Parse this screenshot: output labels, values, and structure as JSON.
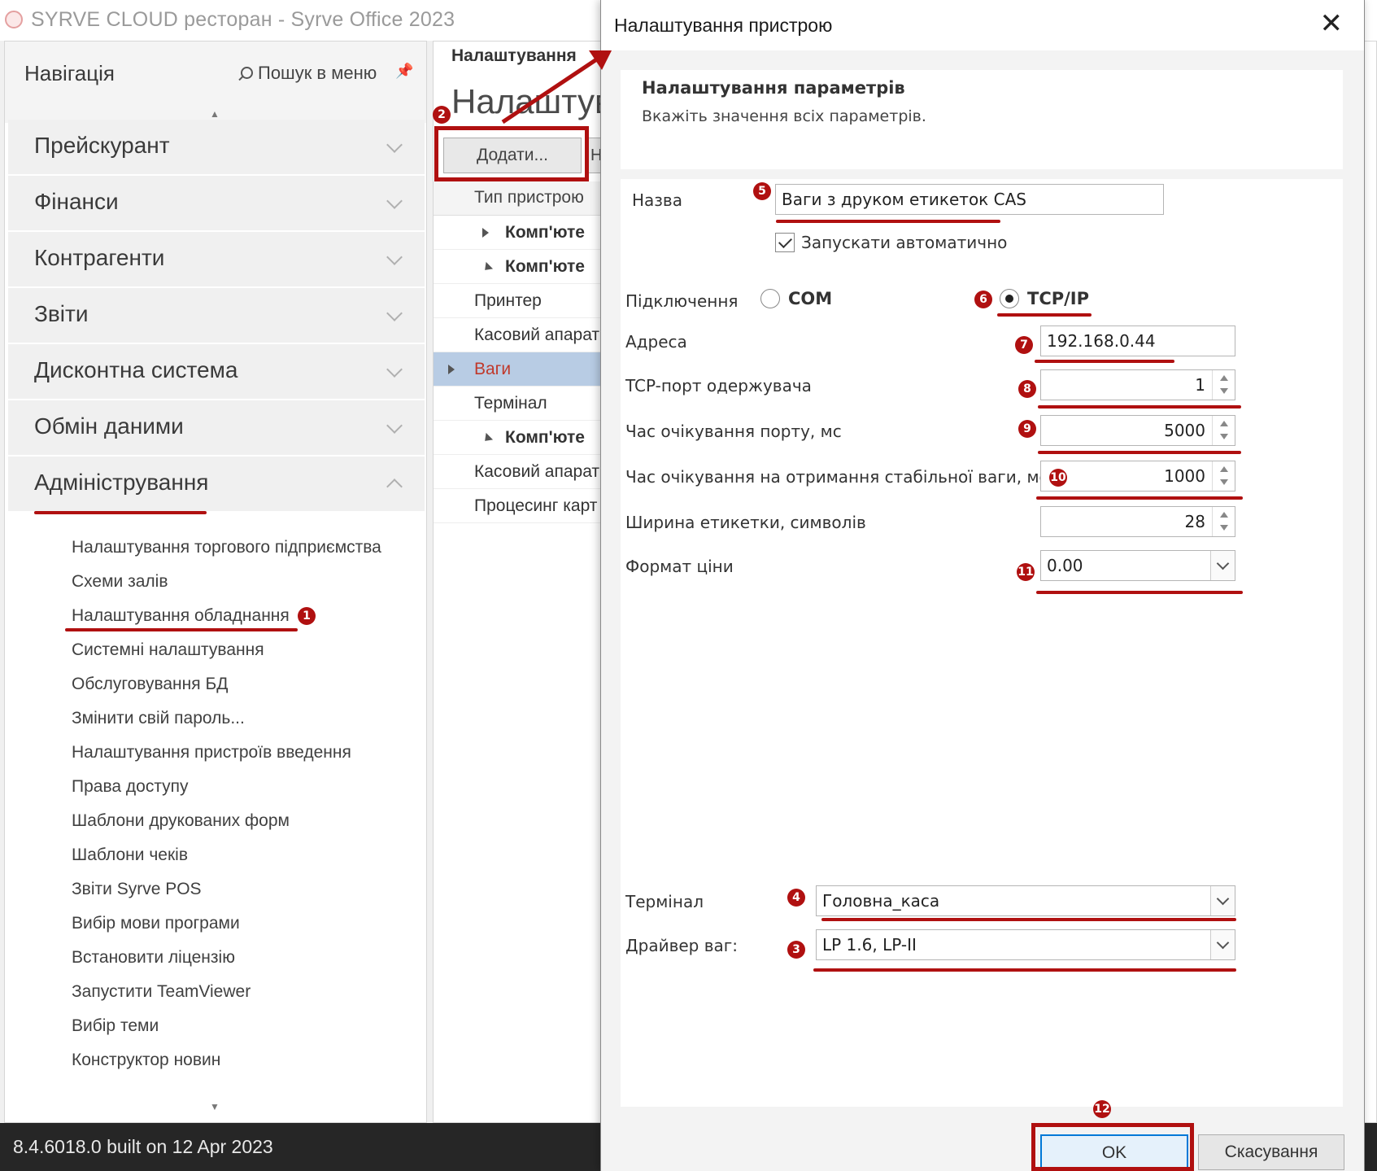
{
  "app": {
    "title": "SYRVE CLOUD ресторан - Syrve Office 2023",
    "status": "8.4.6018.0 built on 12 Apr 2023"
  },
  "nav": {
    "title": "Навігація",
    "search": "Пошук в меню",
    "sections": [
      {
        "label": "Прейскурант"
      },
      {
        "label": "Фінанси"
      },
      {
        "label": "Контрагенти"
      },
      {
        "label": "Звіти"
      },
      {
        "label": "Дисконтна система"
      },
      {
        "label": "Обмін даними"
      },
      {
        "label": "Адміністрування"
      }
    ],
    "items": [
      {
        "label": "Налаштування торгового підприємства"
      },
      {
        "label": "Схеми залів"
      },
      {
        "label": "Налаштування обладнання"
      },
      {
        "label": "Системні налаштування"
      },
      {
        "label": "Обслуговування БД"
      },
      {
        "label": "Змінити свій пароль..."
      },
      {
        "label": "Налаштування пристроїв введення"
      },
      {
        "label": "Права доступу"
      },
      {
        "label": "Шаблони друкованих форм"
      },
      {
        "label": "Шаблони чеків"
      },
      {
        "label": "Звіти Syrve POS"
      },
      {
        "label": "Вибір мови програми"
      },
      {
        "label": "Встановити ліцензію"
      },
      {
        "label": "Запустити TeamViewer"
      },
      {
        "label": "Вибір теми"
      },
      {
        "label": "Конструктор новин"
      }
    ]
  },
  "content": {
    "tab": "Налаштування",
    "heading": "Налаштув",
    "add_button": "Додати...",
    "second_button": "Н",
    "column": "Тип пристрою",
    "rows": [
      {
        "label": "Комп'юте"
      },
      {
        "label": "Комп'юте"
      },
      {
        "label": "Принтер"
      },
      {
        "label": "Касовий апарат"
      },
      {
        "label": "Ваги"
      },
      {
        "label": "Термінал"
      },
      {
        "label": "Комп'юте"
      },
      {
        "label": "Касовий апарат"
      },
      {
        "label": "Процесинг карт"
      }
    ]
  },
  "dialog": {
    "title": "Налаштування пристрою",
    "banner_title": "Налаштування параметрів",
    "banner_subtitle": "Вкажіть значення всіх параметрів.",
    "name_label": "Назва",
    "name_value": "Ваги з друком етикеток CAS",
    "autostart_label": "Запускати автоматично",
    "autostart_checked": true,
    "connection_label": "Підключення",
    "connection_options": [
      "COM",
      "TCP/IP"
    ],
    "connection_selected": "TCP/IP",
    "address_label": "Адреса",
    "address_value": "192.168.0.44",
    "port_label": "TCP-порт одержувача",
    "port_value": "1",
    "port_timeout_label": "Час очікування порту, мс",
    "port_timeout_value": "5000",
    "stable_timeout_label": "Час очікування на отримання стабільної ваги, мс",
    "stable_timeout_value": "1000",
    "label_width_label": "Ширина етикетки, символів",
    "label_width_value": "28",
    "price_format_label": "Формат ціни",
    "price_format_value": "0.00",
    "terminal_label": "Термінал",
    "terminal_value": "Головна_каса",
    "driver_label": "Драйвер ваг:",
    "driver_value": "LP 1.6, LP-II",
    "ok_label": "OK",
    "cancel_label": "Скасування"
  },
  "annotations": {
    "color": "#b01010",
    "badges": [
      "1",
      "2",
      "3",
      "4",
      "5",
      "6",
      "7",
      "8",
      "9",
      "10",
      "11",
      "12"
    ]
  }
}
